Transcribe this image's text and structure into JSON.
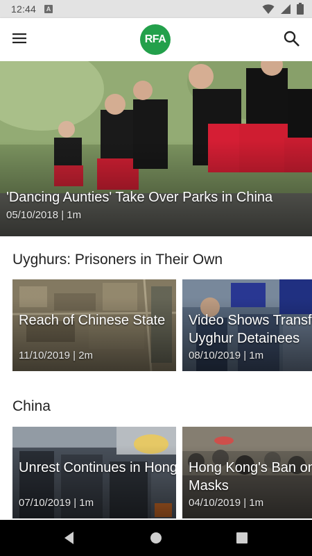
{
  "status_bar": {
    "time": "12:44",
    "notification_badge": "A",
    "icons": [
      "wifi-icon",
      "cell-signal-icon",
      "battery-icon"
    ]
  },
  "app_bar": {
    "logo_text": "RFA",
    "brand_color": "#23a04b",
    "icons": [
      "menu-icon",
      "search-icon"
    ]
  },
  "hero": {
    "title": "'Dancing Aunties' Take Over Parks in China",
    "meta": "05/10/2018 | 1m"
  },
  "sections": [
    {
      "title": "Uyghurs: Prisoners in Their Own",
      "cards": [
        {
          "title": "Reach of Chinese State",
          "meta": "11/10/2019 | 2m"
        },
        {
          "title": "Video Shows Transfer of Uyghur Detainees",
          "meta": "08/10/2019 | 1m"
        }
      ]
    },
    {
      "title": "China",
      "cards": [
        {
          "title": "Unrest Continues in Hong Kong",
          "meta": "07/10/2019 | 1m"
        },
        {
          "title": "Hong Kong's Ban on Masks",
          "meta": "04/10/2019 | 1m"
        }
      ]
    }
  ],
  "nav_bar": {
    "icons": [
      "back-icon",
      "home-icon",
      "recents-icon"
    ]
  }
}
